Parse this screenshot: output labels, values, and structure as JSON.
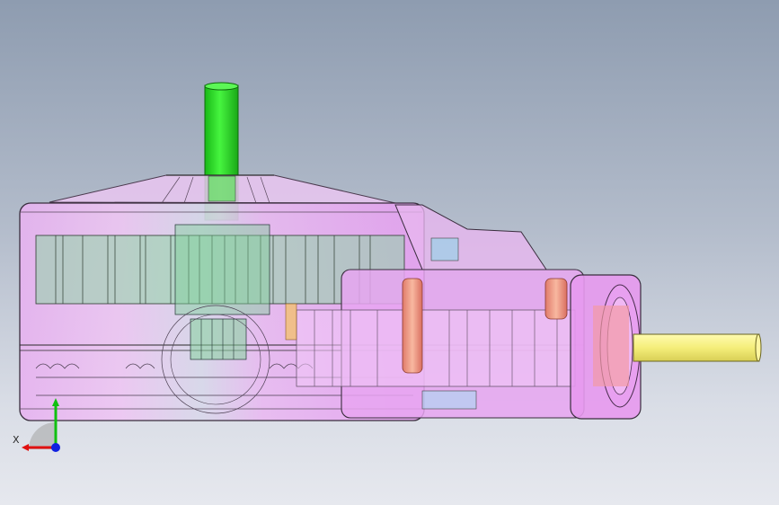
{
  "viewport": {
    "background_top": "#8e9cb0",
    "background_bottom": "#e6e8ee"
  },
  "model": {
    "housing_color": "#e6a9ef",
    "vertical_shaft_color": "#22e21f",
    "horizontal_shaft_color": "#f5f18a",
    "gear_color": "#8fd6a6",
    "pin_color": "#f29a8a"
  },
  "triad": {
    "x_label": "X",
    "x_color": "#e01010",
    "y_color": "#10c010",
    "z_color": "#1020e0"
  }
}
